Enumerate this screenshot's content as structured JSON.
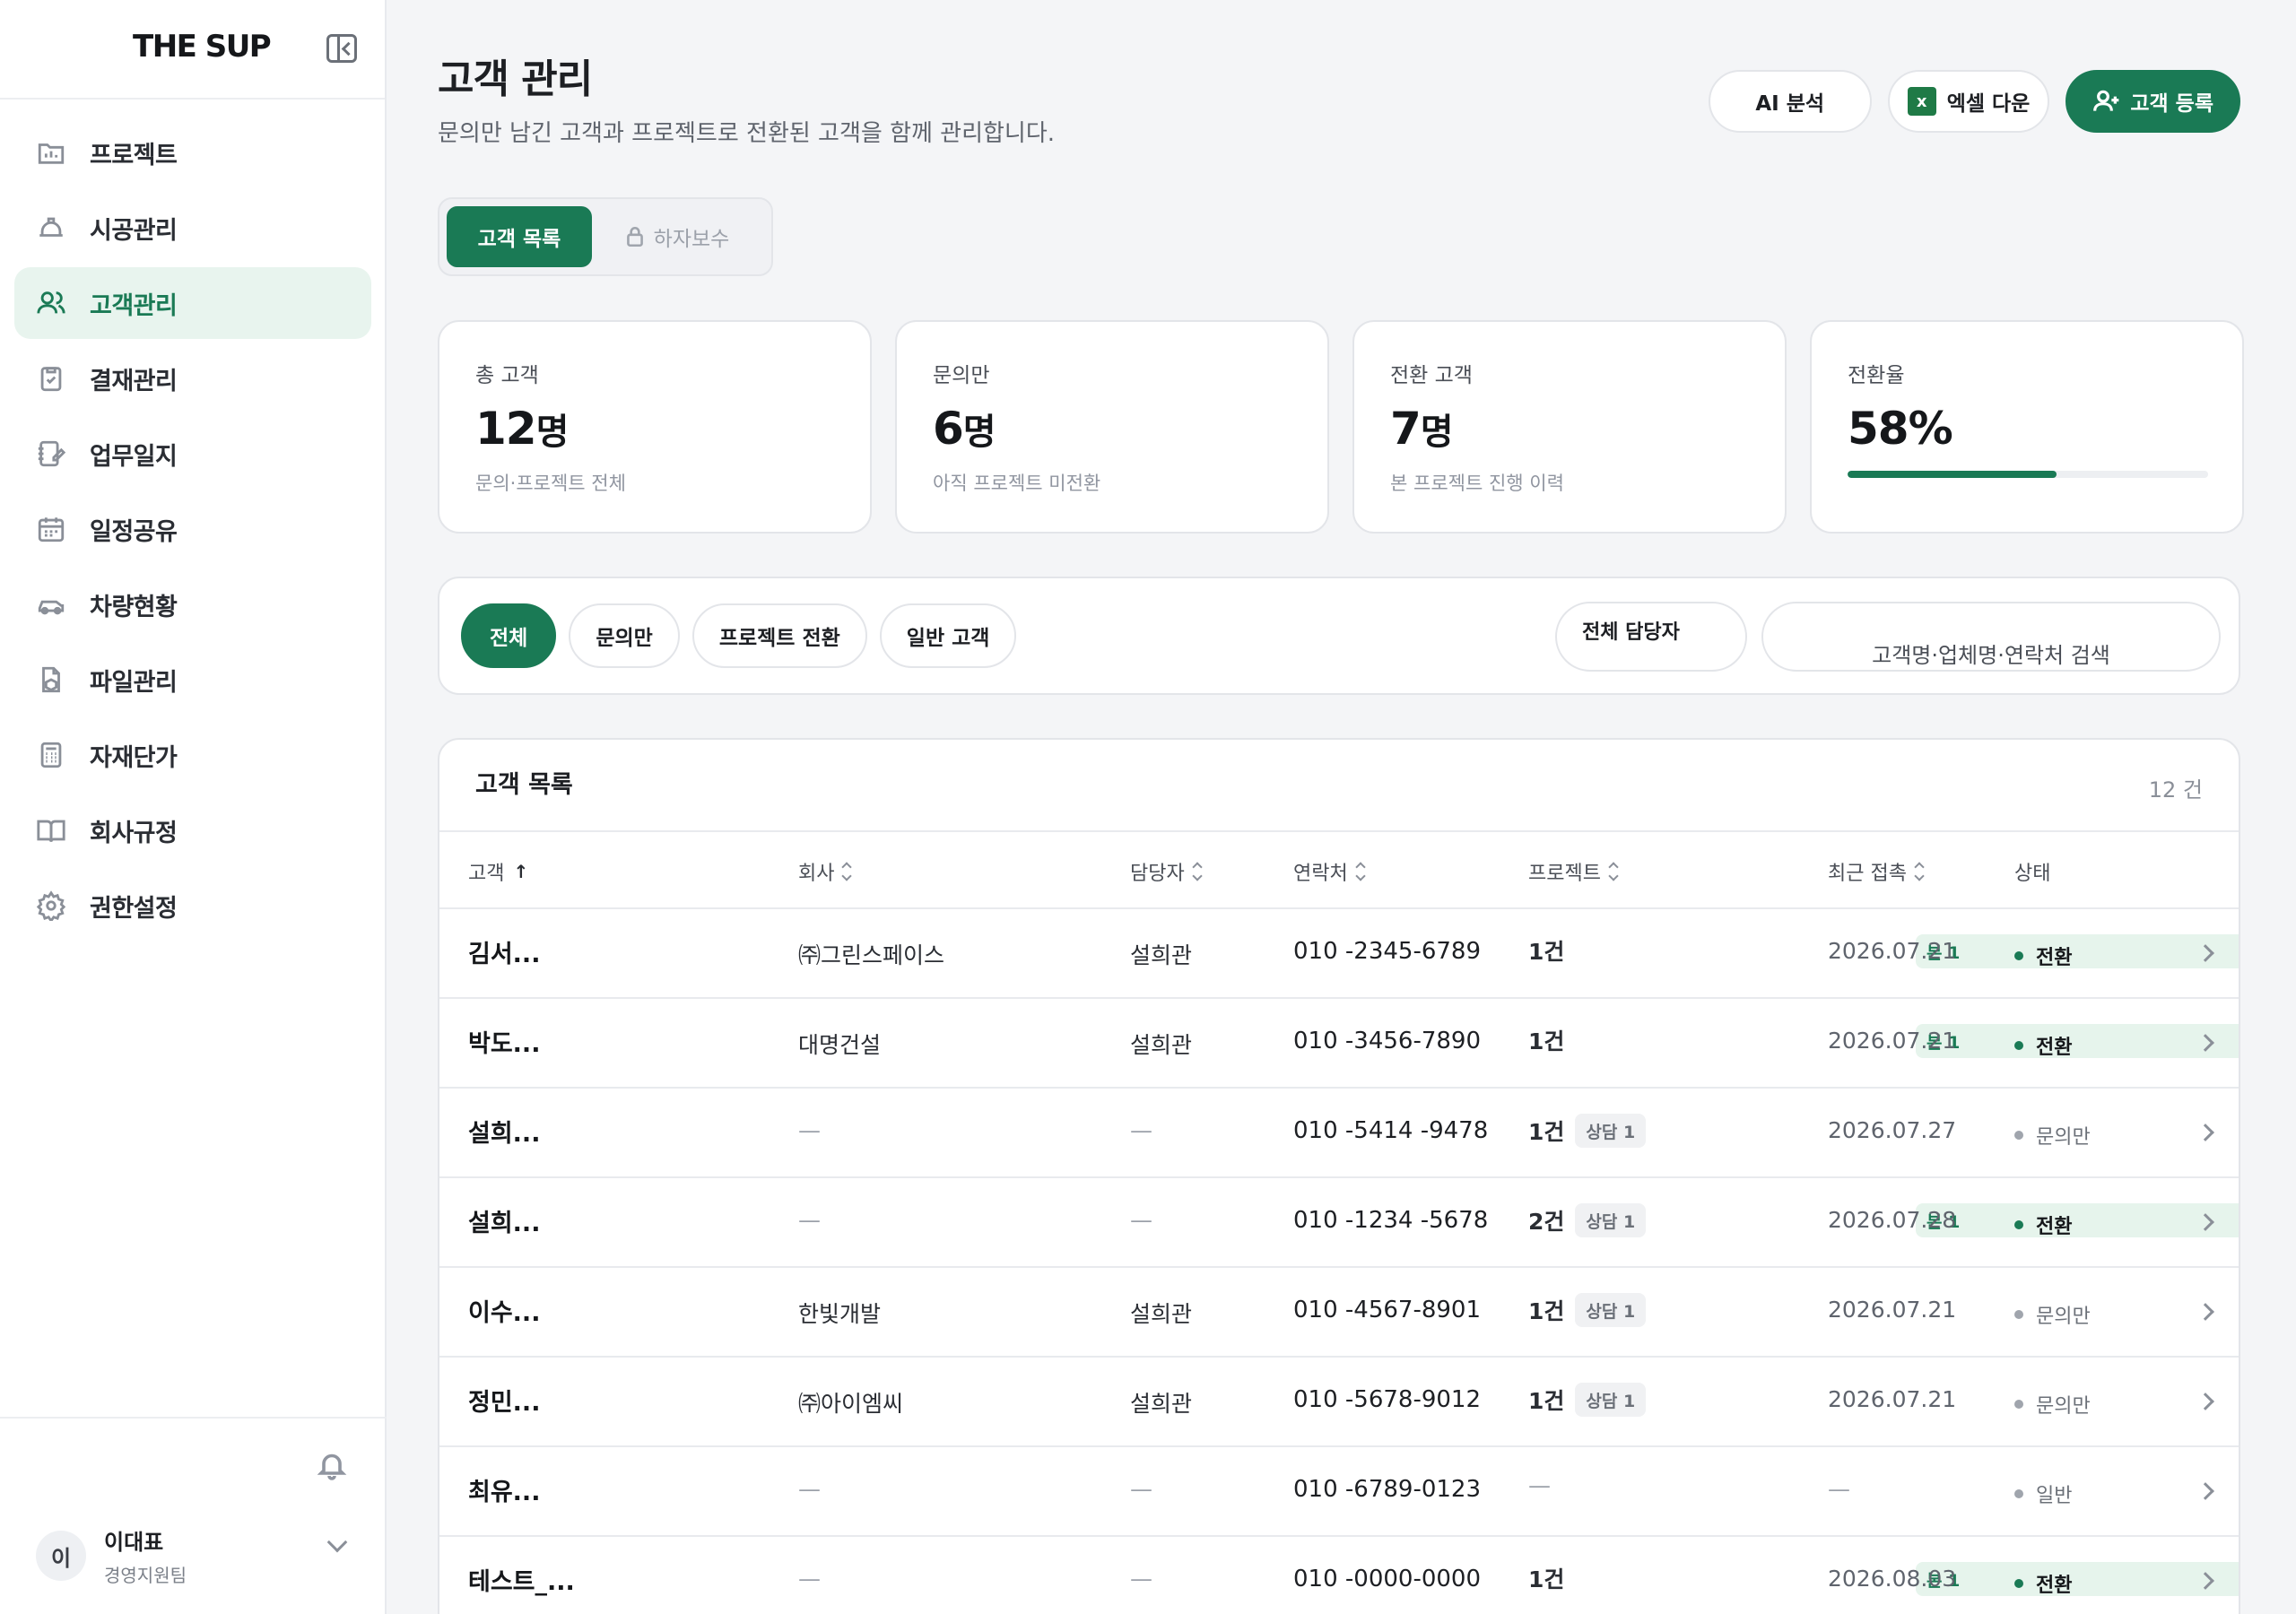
{
  "brand": "THE SUP",
  "sidebar": {
    "items": [
      {
        "label": "프로젝트",
        "icon": "folder-chart-icon"
      },
      {
        "label": "시공관리",
        "icon": "hard-hat-icon"
      },
      {
        "label": "고객관리",
        "icon": "users-icon",
        "active": true
      },
      {
        "label": "결재관리",
        "icon": "clipboard-check-icon"
      },
      {
        "label": "업무일지",
        "icon": "notebook-pen-icon"
      },
      {
        "label": "일정공유",
        "icon": "calendar-icon"
      },
      {
        "label": "차량현황",
        "icon": "car-icon"
      },
      {
        "label": "파일관리",
        "icon": "file-box-icon"
      },
      {
        "label": "자재단가",
        "icon": "calculator-icon"
      },
      {
        "label": "회사규정",
        "icon": "book-open-icon"
      },
      {
        "label": "권한설정",
        "icon": "gear-icon"
      }
    ],
    "user": {
      "initial": "이",
      "name": "이대표",
      "team": "경영지원팀"
    }
  },
  "header": {
    "title": "고객 관리",
    "subtitle": "문의만 남긴 고객과 프로젝트로 전환된 고객을 함께 관리합니다.",
    "ai_label": "AI 분석",
    "excel_label": "엑셀 다운",
    "register_label": "고객 등록"
  },
  "tabs": {
    "customers": "고객 목록",
    "warranty": "하자보수"
  },
  "stats": [
    {
      "label": "총 고객",
      "value": "12",
      "unit": "명",
      "desc": "문의·프로젝트 전체"
    },
    {
      "label": "문의만",
      "value": "6",
      "unit": "명",
      "desc": "아직 프로젝트 미전환"
    },
    {
      "label": "전환 고객",
      "value": "7",
      "unit": "명",
      "desc": "본 프로젝트 진행 이력"
    },
    {
      "label": "전환율",
      "value": "58%",
      "progress": 0.58
    }
  ],
  "filters": {
    "chips": [
      "전체",
      "문의만",
      "프로젝트 전환",
      "일반 고객"
    ],
    "manager_select": "전체 담당자",
    "search_placeholder": "고객명·업체명·연락처 검색"
  },
  "table": {
    "title": "고객 목록",
    "count": "12 건",
    "columns": [
      "고객",
      "회사",
      "담당자",
      "연락처",
      "프로젝트",
      "최근 접촉",
      "상태"
    ],
    "rows": [
      {
        "name": "김서...",
        "company": "㈜그린스페이스",
        "manager": "설희관",
        "phone": "010 -2345-6789",
        "projects": "1건",
        "badges": [
          {
            "t": "본 1",
            "k": "main"
          }
        ],
        "date": "2026.07.21",
        "status": "전환",
        "sk": "converted"
      },
      {
        "name": "박도...",
        "company": "대명건설",
        "manager": "설희관",
        "phone": "010 -3456-7890",
        "projects": "1건",
        "badges": [
          {
            "t": "본 1",
            "k": "main"
          }
        ],
        "date": "2026.07.21",
        "status": "전환",
        "sk": "converted"
      },
      {
        "name": "설희...",
        "company": "—",
        "manager": "—",
        "phone": "010 -5414 -9478",
        "projects": "1건",
        "badges": [
          {
            "t": "상담 1",
            "k": "consult"
          }
        ],
        "date": "2026.07.27",
        "status": "문의만",
        "sk": "other"
      },
      {
        "name": "설희...",
        "company": "—",
        "manager": "—",
        "phone": "010 -1234 -5678",
        "projects": "2건",
        "badges": [
          {
            "t": "상담 1",
            "k": "consult"
          },
          {
            "t": "본 1",
            "k": "main"
          }
        ],
        "date": "2026.07.28",
        "status": "전환",
        "sk": "converted"
      },
      {
        "name": "이수...",
        "company": "한빛개발",
        "manager": "설희관",
        "phone": "010 -4567-8901",
        "projects": "1건",
        "badges": [
          {
            "t": "상담 1",
            "k": "consult"
          }
        ],
        "date": "2026.07.21",
        "status": "문의만",
        "sk": "other"
      },
      {
        "name": "정민...",
        "company": "㈜아이엠씨",
        "manager": "설희관",
        "phone": "010 -5678-9012",
        "projects": "1건",
        "badges": [
          {
            "t": "상담 1",
            "k": "consult"
          }
        ],
        "date": "2026.07.21",
        "status": "문의만",
        "sk": "other"
      },
      {
        "name": "최유...",
        "company": "—",
        "manager": "—",
        "phone": "010 -6789-0123",
        "projects": "—",
        "badges": [],
        "date": "—",
        "status": "일반",
        "sk": "other"
      },
      {
        "name": "테스트_...",
        "company": "—",
        "manager": "—",
        "phone": "010 -0000-0000",
        "projects": "1건",
        "badges": [
          {
            "t": "본 1",
            "k": "main"
          }
        ],
        "date": "2026.08.03",
        "status": "전환",
        "sk": "converted"
      }
    ]
  },
  "colors": {
    "accent": "#1a7a55",
    "accent_soft": "#e8f4ee"
  }
}
